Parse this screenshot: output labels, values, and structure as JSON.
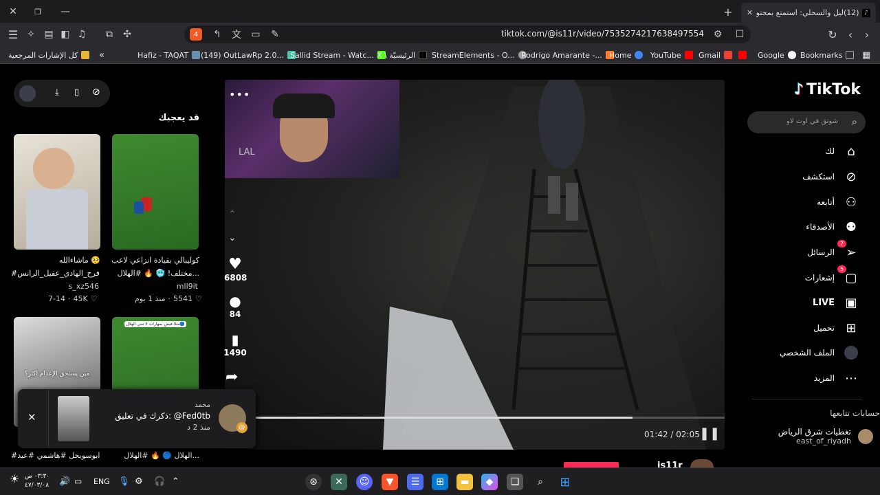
{
  "browser": {
    "tab_title": "(12)ليل والسحلي: استمتع بمحتو",
    "url": "tiktok.com/@is11r/video/7535274217638497554",
    "shield_count": "4"
  },
  "bookmarks": {
    "all_label": "كل الإشارات المرجعية",
    "items": [
      "Hafiz - TAQAT",
      "(149) OutLawRp 2.0...",
      "Sallid Stream - Watc...",
      "X \\ الرئيسيّة",
      "StreamElements - O...",
      "Rodrigo Amarante -...",
      "Home",
      "YouTube",
      "Gmail",
      "Google",
      "Bookmarks"
    ]
  },
  "sidebar": {
    "logo": "TikTok",
    "search_placeholder": "شوتق في اوت لاو",
    "items": [
      {
        "label": "لك"
      },
      {
        "label": "استكشف"
      },
      {
        "label": "أتابعه"
      },
      {
        "label": "الأصدقاء"
      },
      {
        "label": "الرسائل",
        "badge": "7"
      },
      {
        "label": "إشعارات",
        "badge": "5"
      },
      {
        "label": "LIVE"
      },
      {
        "label": "تحميل"
      },
      {
        "label": "الملف الشخصي"
      },
      {
        "label": "المزيد"
      }
    ],
    "following_title": "حسابات تتابعها",
    "following": [
      {
        "name": "تغطيات شرق الرياض",
        "handle": "east_of_riyadh"
      }
    ]
  },
  "video": {
    "time": "01:42 / 02:05",
    "progress": 0.816,
    "stream_tag": "LAL",
    "likes": "6808",
    "comments": "84",
    "saves": "1490",
    "author_partial": "is11r"
  },
  "recommend": {
    "title": "قد يعجبك",
    "cards": [
      {
        "caption1": "كوليبالي بقيادة انزاعي لاعب",
        "caption2": "مختلف! 🥶 🔥 #الهلال...",
        "user": "mll9it",
        "likes": "5541",
        "age": "منذ 1 يوم"
      },
      {
        "caption1": "ماشاءالله 🥺",
        "caption2": "#فرح_الهادي_عقيل_الرانس...",
        "user": "s_xz546",
        "likes": "45K",
        "age": "7-14"
      },
      {
        "caption1": "الهلال 🔵 🔥 #الهلال...",
        "overlay": "مثلا فيش بمهارات لا سي الهلال🔵"
      },
      {
        "caption1": "#ابوسويحل #هاشمي #عيد...",
        "overlay": "مين يستحق الإعدام اكثر؟"
      }
    ]
  },
  "notification": {
    "name": "محمد",
    "text": "ذكرك في تعليق: @Fed0tb",
    "time": "منذ 2 د"
  },
  "taskbar": {
    "lang": "ENG",
    "time": "٠٣:٣٠ ص",
    "date": "٤٧/٠٣/٠٨"
  }
}
